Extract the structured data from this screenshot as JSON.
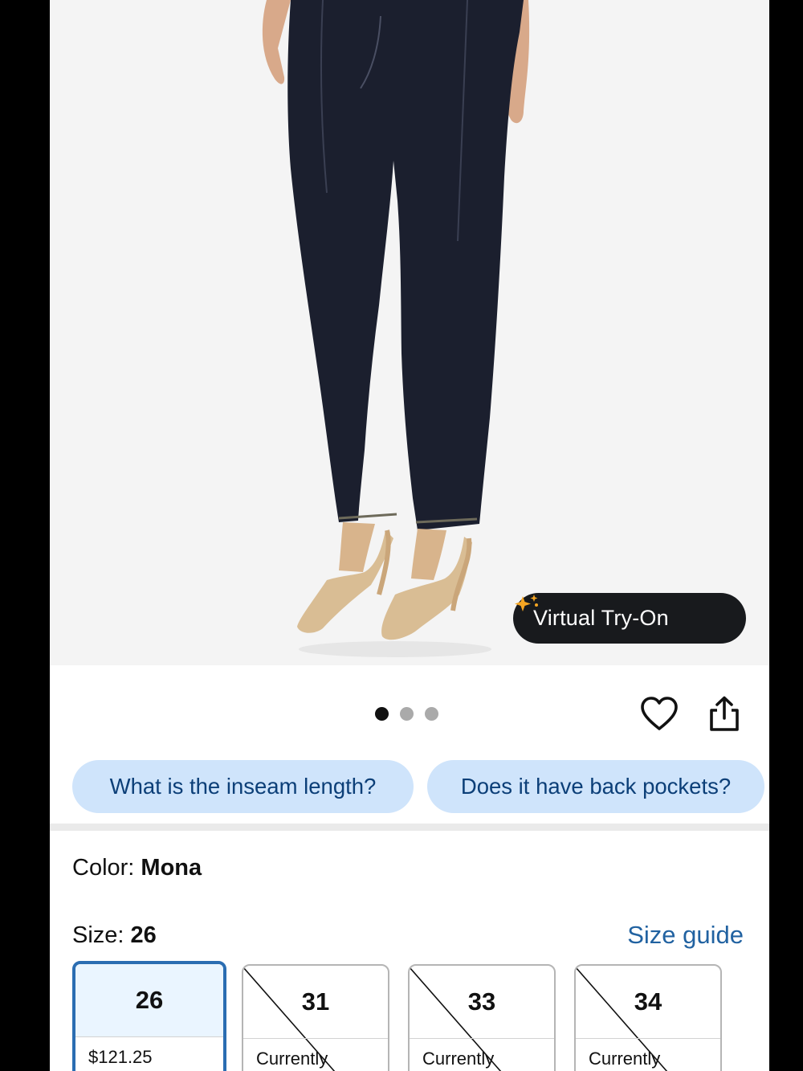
{
  "product_image": {
    "try_on_label": "Virtual Try-On",
    "try_on_icon": "sparkle-icon",
    "carousel": {
      "count": 3,
      "active_index": 0
    }
  },
  "actions": {
    "favorite_icon": "heart-icon",
    "share_icon": "share-icon"
  },
  "questions": [
    "What is the inseam length?",
    "Does it have back pockets?"
  ],
  "color": {
    "label": "Color: ",
    "value": "Mona"
  },
  "size": {
    "label": "Size: ",
    "value": "26",
    "guide_label": "Size guide",
    "options": [
      {
        "size": "26",
        "detail": "$121.25",
        "available": true,
        "selected": true
      },
      {
        "size": "31",
        "detail": "Currently",
        "available": false,
        "selected": false
      },
      {
        "size": "33",
        "detail": "Currently",
        "available": false,
        "selected": false
      },
      {
        "size": "34",
        "detail": "Currently",
        "available": false,
        "selected": false
      }
    ]
  },
  "colors": {
    "chip_bg": "#cfe4fb",
    "chip_text": "#0c3f78",
    "link": "#2162a1",
    "selected_border": "#2a6db2",
    "try_on_bg": "#181a1d",
    "sparkle": "#f6a623"
  }
}
